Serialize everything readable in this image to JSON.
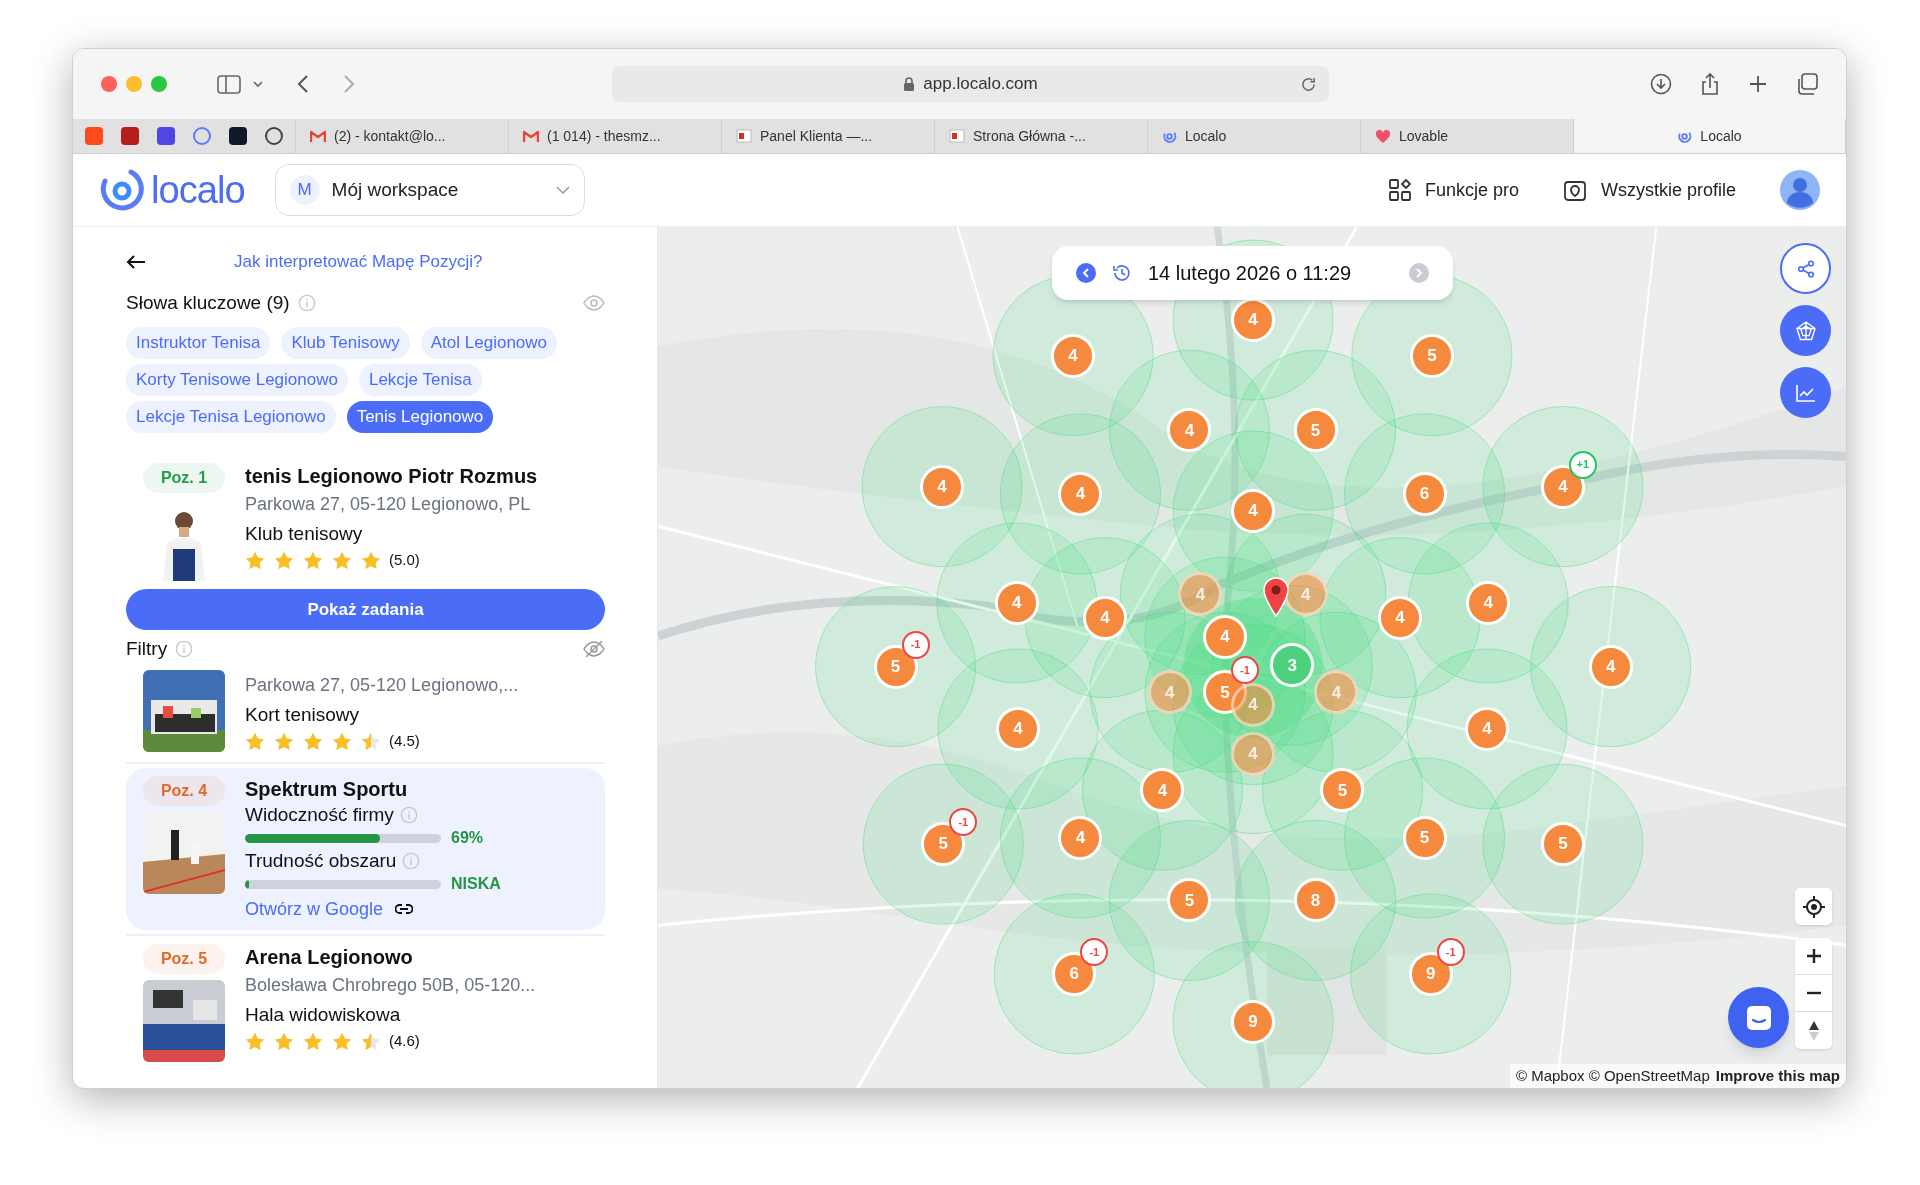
{
  "browser": {
    "url": "app.localo.com",
    "tabs": [
      {
        "label": "(2) - kontakt@lo...",
        "kind": "mail",
        "selected": false
      },
      {
        "label": "(1 014) - thesmz...",
        "kind": "mail",
        "selected": false
      },
      {
        "label": "Panel Klienta —...",
        "kind": "page",
        "selected": false
      },
      {
        "label": "Strona Główna -...",
        "kind": "page",
        "selected": false
      },
      {
        "label": "Localo",
        "kind": "localo",
        "selected": false
      },
      {
        "label": "Lovable",
        "kind": "heart",
        "selected": false
      },
      {
        "label": "Localo",
        "kind": "localo",
        "selected": true
      }
    ]
  },
  "header": {
    "logo": "localo",
    "workspace": {
      "initial": "M",
      "name": "Mój workspace"
    },
    "actions": [
      {
        "label": "Funkcje pro",
        "kind": "grid"
      },
      {
        "label": "Wszystkie profile",
        "kind": "profile"
      }
    ]
  },
  "panel": {
    "help_link": "Jak interpretować Mapę Pozycji?",
    "keywords": {
      "title": "Słowa kluczowe (9)",
      "items": [
        {
          "label": "Instruktor Tenisa",
          "selected": false
        },
        {
          "label": "Klub Tenisowy",
          "selected": false
        },
        {
          "label": "Atol Legionowo",
          "selected": false
        },
        {
          "label": "Korty Tenisowe Legionowo",
          "selected": false
        },
        {
          "label": "Lekcje Tenisa",
          "selected": false
        },
        {
          "label": "Lekcje Tenisa Legionowo",
          "selected": false
        },
        {
          "label": "Tenis Legionowo",
          "selected": true
        }
      ]
    },
    "filters_title": "Filtry",
    "results": [
      {
        "kind": "listing",
        "selected": false,
        "badge": "Poz. 1",
        "color": "#1f9d4a",
        "title": "tenis Legionowo Piotr Rozmus",
        "address": "Parkowa 27, 05-120 Legionowo, PL",
        "category": "Klub tenisowy",
        "stars": 5,
        "rating": "(5.0)",
        "button": "Pokaż zadania"
      },
      {
        "kind": "listing",
        "selected": false,
        "address": "Parkowa 27, 05-120 Legionowo,...",
        "category": "Kort tenisowy",
        "stars": 4.5,
        "rating": "(4.5)"
      },
      {
        "kind": "metrics",
        "selected": true,
        "badge": "Poz. 4",
        "color": "#e0692a",
        "title": "Spektrum Sportu",
        "metrics": [
          {
            "label": "Widoczność firmy",
            "level": 0.69,
            "reading": "69%"
          },
          {
            "label": "Trudność obszaru",
            "level": 0.02,
            "reading": "NISKA"
          }
        ],
        "link": "Otwórz w Google"
      },
      {
        "kind": "listing",
        "selected": false,
        "badge": "Poz. 5",
        "color": "#e0692a",
        "title": "Arena Legionowo",
        "address": "Bolesława Chrobrego 50B, 05-120...",
        "category": "Hala widowiskowa",
        "stars": 4.5,
        "rating": "(4.6)"
      }
    ]
  },
  "map": {
    "date": "14 lutego 2026 o 11:29",
    "next_disabled": true,
    "markers": [
      {
        "value": "4",
        "kind": "standard"
      },
      {
        "value": "4",
        "kind": "standard"
      },
      {
        "value": "5",
        "kind": "standard"
      },
      {
        "value": "4",
        "kind": "standard"
      },
      {
        "value": "5",
        "kind": "standard"
      },
      {
        "value": "4",
        "kind": "standard"
      },
      {
        "value": "4",
        "kind": "standard"
      },
      {
        "value": "4",
        "kind": "standard"
      },
      {
        "value": "6",
        "kind": "standard"
      },
      {
        "value": "4",
        "kind": "standard",
        "change": {
          "text": "+1",
          "color": "#22c55e"
        }
      },
      {
        "value": "4",
        "kind": "standard"
      },
      {
        "value": "4",
        "kind": "standard"
      },
      {
        "value": "4",
        "kind": "dimmed"
      },
      {
        "value": "4",
        "kind": "standard"
      },
      {
        "value": "4",
        "kind": "dimmed"
      },
      {
        "value": "4",
        "kind": "standard"
      },
      {
        "value": "4",
        "kind": "standard"
      },
      {
        "value": "5",
        "kind": "standard",
        "change": {
          "text": "-1",
          "color": "#ef4444"
        }
      },
      {
        "value": "4",
        "kind": "dimmed"
      },
      {
        "value": "5",
        "kind": "standard",
        "change": {
          "text": "-1",
          "color": "#ef4444"
        }
      },
      {
        "value": "4",
        "kind": "dimmed"
      },
      {
        "value": "3",
        "kind": "best"
      },
      {
        "value": "4",
        "kind": "dimmed"
      },
      {
        "value": "4",
        "kind": "standard"
      },
      {
        "value": "4",
        "kind": "standard"
      },
      {
        "value": "4",
        "kind": "dimmed"
      },
      {
        "value": "4",
        "kind": "standard"
      },
      {
        "value": "4",
        "kind": "standard"
      },
      {
        "value": "5",
        "kind": "standard"
      },
      {
        "value": "5",
        "kind": "standard",
        "change": {
          "text": "-1",
          "color": "#ef4444"
        }
      },
      {
        "value": "4",
        "kind": "standard"
      },
      {
        "value": "5",
        "kind": "standard"
      },
      {
        "value": "5",
        "kind": "standard"
      },
      {
        "value": "5",
        "kind": "standard"
      },
      {
        "value": "8",
        "kind": "standard"
      },
      {
        "value": "6",
        "kind": "standard",
        "change": {
          "text": "-1",
          "color": "#ef4444"
        }
      },
      {
        "value": "9",
        "kind": "standard",
        "change": {
          "text": "-1",
          "color": "#ef4444"
        }
      },
      {
        "value": "9",
        "kind": "standard"
      }
    ],
    "attribution": "© Mapbox © OpenStreetMap",
    "improve_link": "Improve this map"
  }
}
